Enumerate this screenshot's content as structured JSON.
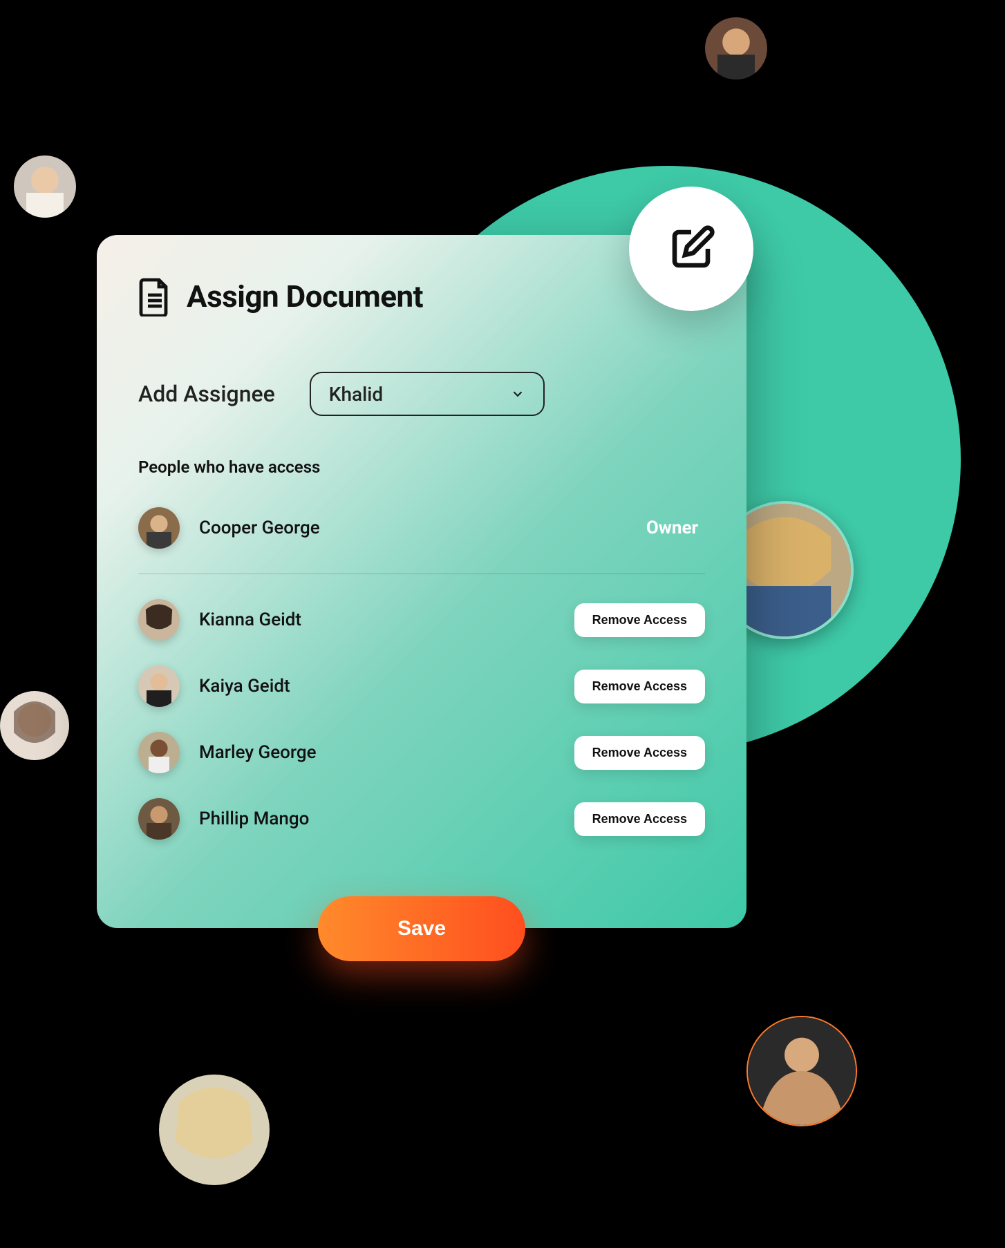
{
  "modal": {
    "title": "Assign Document",
    "add_assignee_label": "Add Assignee",
    "selected_assignee": "Khalid",
    "access_section_label": "People who have access",
    "owner": {
      "name": "Cooper George",
      "role_label": "Owner"
    },
    "people": [
      {
        "name": "Kianna Geidt"
      },
      {
        "name": "Kaiya Geidt"
      },
      {
        "name": "Marley George"
      },
      {
        "name": "Phillip Mango"
      }
    ],
    "remove_label": "Remove Access",
    "save_label": "Save"
  }
}
